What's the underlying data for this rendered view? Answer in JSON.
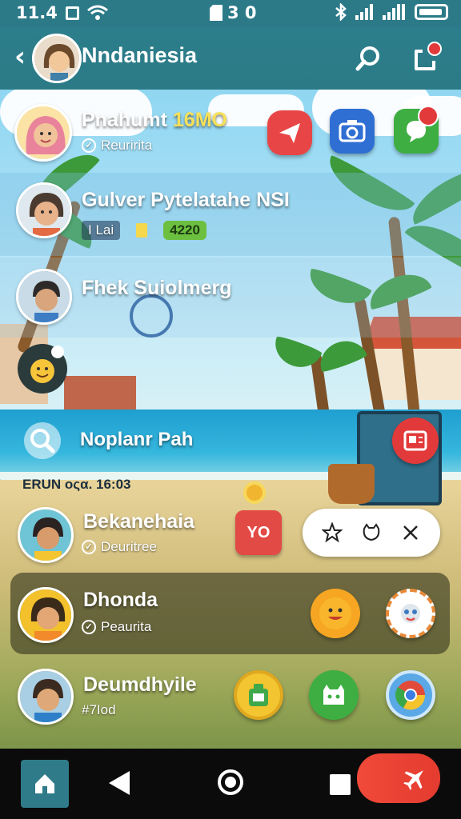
{
  "status_bar": {
    "time": "11.4",
    "center_text": "3 0",
    "icons": [
      "square-icon",
      "wifi-icon",
      "sim-icon",
      "bluetooth-icon",
      "signal-icon",
      "signal-icon",
      "battery-icon"
    ]
  },
  "header": {
    "title": "Nndaniesia"
  },
  "chats": [
    {
      "name": "Pnahumt ",
      "name_highlight": "16MO",
      "status": "Reuririta"
    },
    {
      "name": "Gulver Pytelatahe NSI",
      "tag": "I  Lai",
      "badge": "4220"
    },
    {
      "name": "Fhek Suiolmerg"
    }
  ],
  "search": {
    "label": "Noplanr Pah",
    "section_label": "ERUN  οςα. 16:03"
  },
  "contacts": [
    {
      "name": "Bekanehaia",
      "status": "Deuritree",
      "badge_text": "YO"
    },
    {
      "name": "Dhonda",
      "status": "Peaurita"
    },
    {
      "name": "Deumdhyile",
      "status": "#7Iod"
    }
  ],
  "colors": {
    "header_bg": "#2c7a88",
    "accent_red": "#e23a3a",
    "selected_card": "#46462a"
  }
}
